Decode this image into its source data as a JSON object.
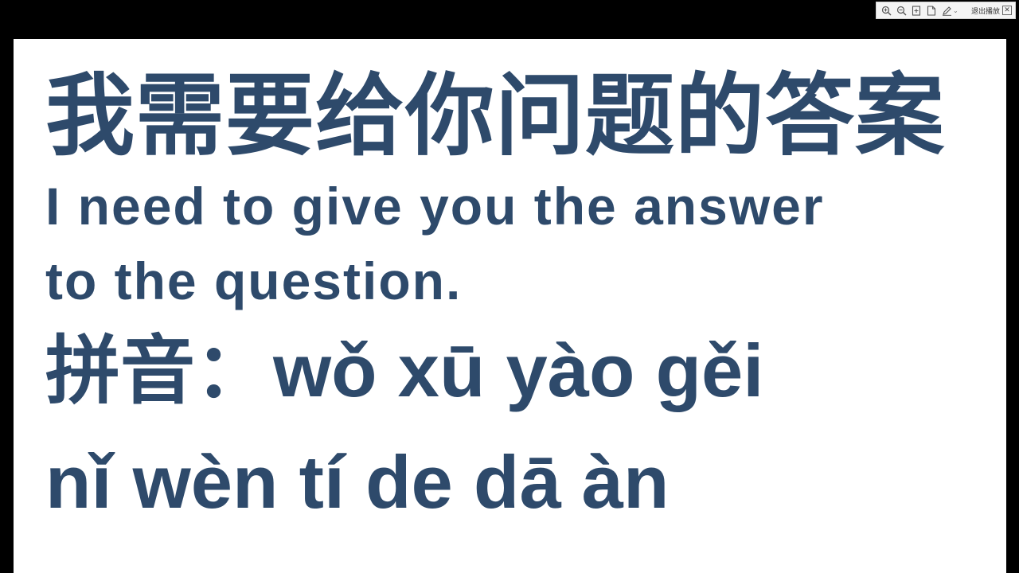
{
  "toolbar": {
    "buttons": [
      {
        "icon": "zoom-in-icon"
      },
      {
        "icon": "zoom-out-icon"
      },
      {
        "icon": "fit-page-icon"
      },
      {
        "icon": "page-icon"
      },
      {
        "icon": "pen-icon"
      }
    ],
    "caret": "⌄",
    "exit_label": "退出播放",
    "close_glyph": "✕"
  },
  "slide": {
    "chinese_sentence": "我需要给你问题的答案",
    "english_line1": "I need to give you  the answer",
    "english_line2": "to the question.",
    "pinyin_label": "拼音：",
    "pinyin_line1": "wǒ xū yào gěi",
    "pinyin_line2": "nǐ wèn tí de dā àn",
    "text_color": "#2e4a6b"
  }
}
